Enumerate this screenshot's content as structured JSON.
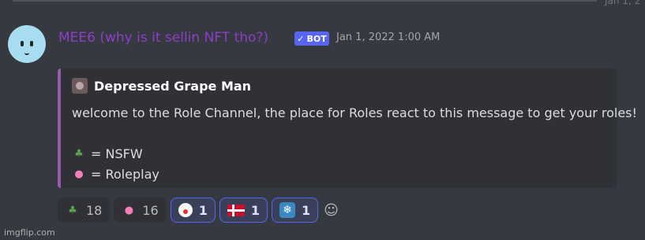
{
  "header": {
    "date": "Jan 1, 2"
  },
  "message": {
    "username": "MEE6 (why is it sellin NFT tho?)",
    "bot_tag": "BOT",
    "timestamp": "Jan 1, 2022 1:00 AM"
  },
  "embed": {
    "author": "Depressed Grape Man",
    "description": "welcome to the Role Channel, the place for Roles react to this message to get your roles!",
    "roles": [
      {
        "emoji": "green-character-emoji",
        "label": "= NSFW"
      },
      {
        "emoji": "pink-character-emoji",
        "label": "= Roleplay"
      }
    ],
    "accent_color": "#9b59b6"
  },
  "reactions": [
    {
      "emoji": "green-character-emoji",
      "count": "18"
    },
    {
      "emoji": "pink-character-emoji",
      "count": "16"
    },
    {
      "emoji": "clown-emoji",
      "count": "1"
    },
    {
      "emoji": "denmark-flag-emoji",
      "count": "1"
    },
    {
      "emoji": "snowflake-emoji",
      "count": "1"
    }
  ],
  "watermark": "imgflip.com",
  "colors": {
    "background": "#36393f",
    "username": "#8b3fc7",
    "bot_tag": "#5865f2"
  }
}
